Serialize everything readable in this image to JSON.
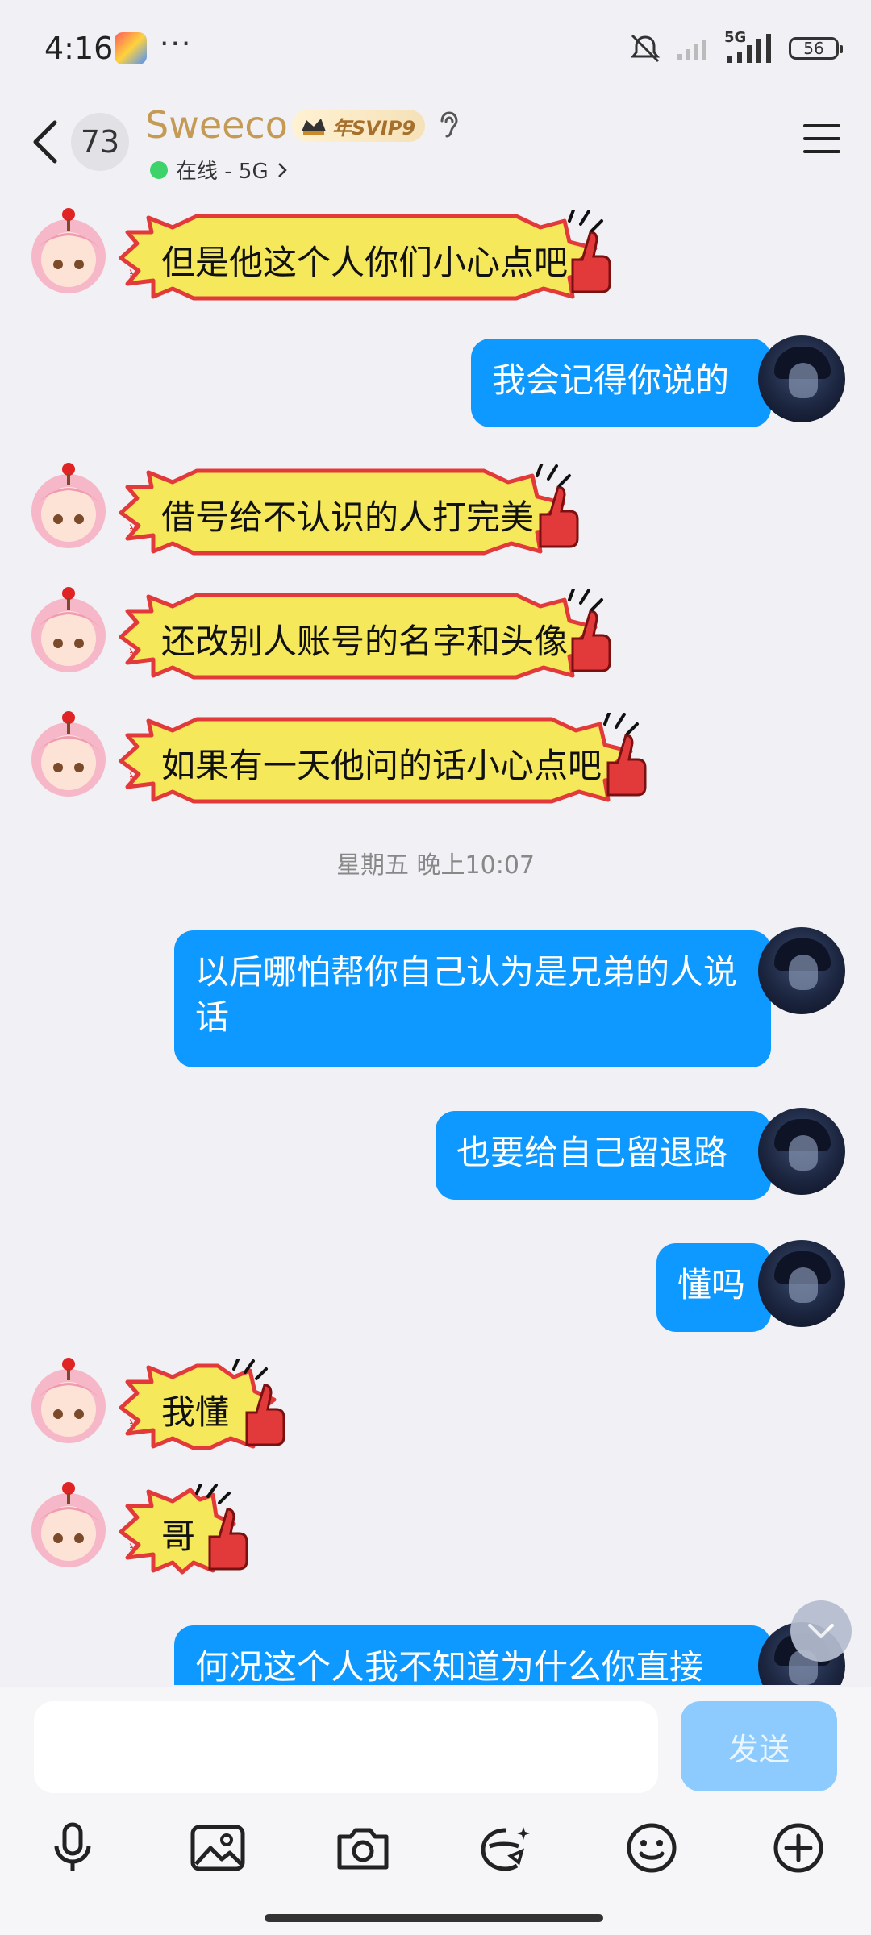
{
  "status_bar": {
    "time": "4:16",
    "net_label": "5G",
    "battery": "56"
  },
  "header": {
    "unread_count": "73",
    "contact_name": "Sweeco",
    "vip_label": "年SVIP9",
    "presence": "在线 - 5G"
  },
  "messages": [
    {
      "side": "in",
      "text": "但是他这个人你们小心点吧"
    },
    {
      "side": "out",
      "text": "我会记得你说的"
    },
    {
      "side": "in",
      "text": "借号给不认识的人打完美"
    },
    {
      "side": "in",
      "text": "还改别人账号的名字和头像"
    },
    {
      "side": "in",
      "text": "如果有一天他问的话小心点吧"
    },
    {
      "side": "out",
      "text": "以后哪怕帮你自己认为是兄弟的人说话"
    },
    {
      "side": "out",
      "text": "也要给自己留退路"
    },
    {
      "side": "out",
      "text": "懂吗"
    },
    {
      "side": "in",
      "text": "我懂"
    },
    {
      "side": "in",
      "text": "哥"
    },
    {
      "side": "out",
      "text": "何况这个人我不知道为什么你直接"
    }
  ],
  "timestamp": "星期五 晚上10:07",
  "input": {
    "placeholder": "",
    "send_label": "发送"
  },
  "toolbar": [
    "mic-icon",
    "image-icon",
    "camera-icon",
    "sticker-icon",
    "emoji-icon",
    "plus-icon"
  ],
  "colors": {
    "outgoing_bubble": "#0d99ff",
    "incoming_bubble": "#f5e85a",
    "incoming_border": "#e23a3a",
    "name_gold": "#c49a55",
    "send_disabled": "#8dcbff"
  }
}
